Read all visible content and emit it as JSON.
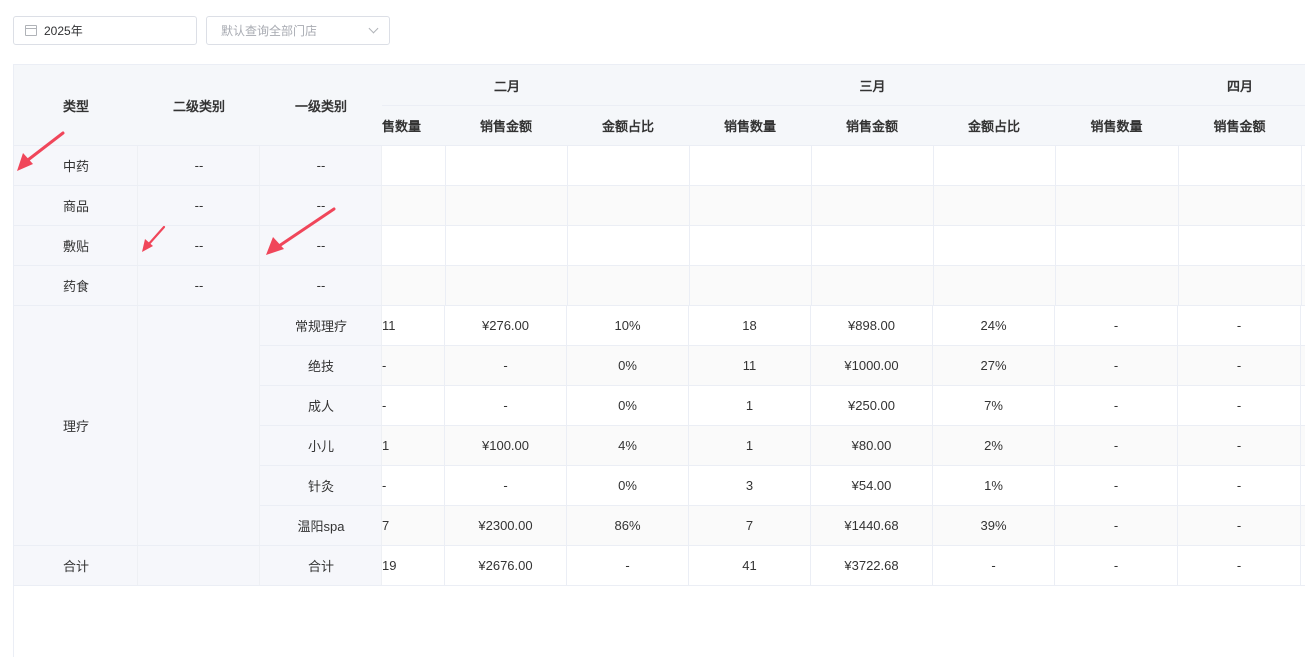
{
  "filters": {
    "year": "2025年",
    "store_placeholder": "默认查询全部门店"
  },
  "fixed_headers": {
    "type": "类型",
    "level2": "二级类别",
    "level1": "一级类别"
  },
  "months": [
    "二月",
    "三月",
    "四月"
  ],
  "sub_headers": {
    "qty": "销售数量",
    "amount": "销售金额",
    "ratio": "金额占比",
    "qty_partial": "售数量"
  },
  "simple_rows": [
    {
      "type": "中药",
      "level2": "--",
      "level1": "--"
    },
    {
      "type": "商品",
      "level2": "--",
      "level1": "--"
    },
    {
      "type": "敷贴",
      "level2": "--",
      "level1": "--"
    },
    {
      "type": "药食",
      "level2": "--",
      "level1": "--"
    }
  ],
  "therapy": {
    "type": "理疗",
    "rows": [
      {
        "level1": "常规理疗",
        "c1": "11",
        "c2": "¥276.00",
        "c3": "10%",
        "c4": "18",
        "c5": "¥898.00",
        "c6": "24%",
        "c7": "-",
        "c8": "-"
      },
      {
        "level1": "绝技",
        "c1": "-",
        "c2": "-",
        "c3": "0%",
        "c4": "11",
        "c5": "¥1000.00",
        "c6": "27%",
        "c7": "-",
        "c8": "-"
      },
      {
        "level1": "成人",
        "c1": "-",
        "c2": "-",
        "c3": "0%",
        "c4": "1",
        "c5": "¥250.00",
        "c6": "7%",
        "c7": "-",
        "c8": "-"
      },
      {
        "level1": "小儿",
        "c1": "1",
        "c2": "¥100.00",
        "c3": "4%",
        "c4": "1",
        "c5": "¥80.00",
        "c6": "2%",
        "c7": "-",
        "c8": "-"
      },
      {
        "level1": "针灸",
        "c1": "-",
        "c2": "-",
        "c3": "0%",
        "c4": "3",
        "c5": "¥54.00",
        "c6": "1%",
        "c7": "-",
        "c8": "-"
      },
      {
        "level1": "温阳spa",
        "c1": "7",
        "c2": "¥2300.00",
        "c3": "86%",
        "c4": "7",
        "c5": "¥1440.68",
        "c6": "39%",
        "c7": "-",
        "c8": "-"
      }
    ]
  },
  "total": {
    "type": "合计",
    "level1": "合计",
    "c1": "19",
    "c2": "¥2676.00",
    "c3": "-",
    "c4": "41",
    "c5": "¥3722.68",
    "c6": "-",
    "c7": "-",
    "c8": "-"
  },
  "colors": {
    "arrow": "#f0465a",
    "header_bg": "#f5f7fa",
    "fixed_bg": "#f6f7fb",
    "border": "#ebeef5"
  }
}
